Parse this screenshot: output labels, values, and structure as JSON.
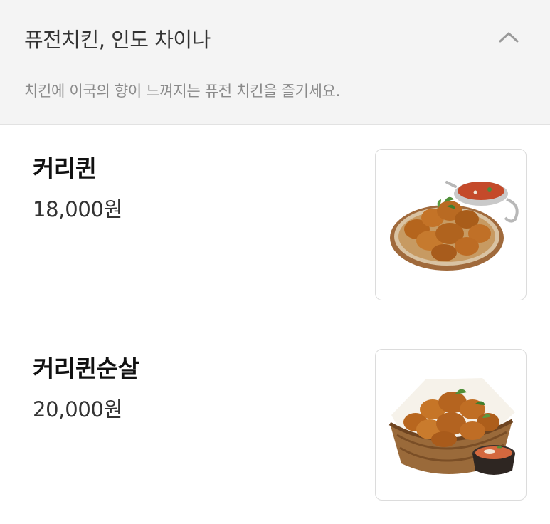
{
  "category": {
    "title": "퓨전치킨, 인도 차이나",
    "description": "치킨에 이국의 향이 느껴지는 퓨전 치킨을 즐기세요.",
    "toggle_icon": "chevron-up-icon",
    "header_bg": "#f4f4f4"
  },
  "menu": {
    "items": [
      {
        "name": "커리퀸",
        "price": "18,000원",
        "image_icon": "curry-chicken-plate-image"
      },
      {
        "name": "커리퀸순살",
        "price": "20,000원",
        "image_icon": "boneless-curry-chicken-basket-image"
      }
    ]
  }
}
